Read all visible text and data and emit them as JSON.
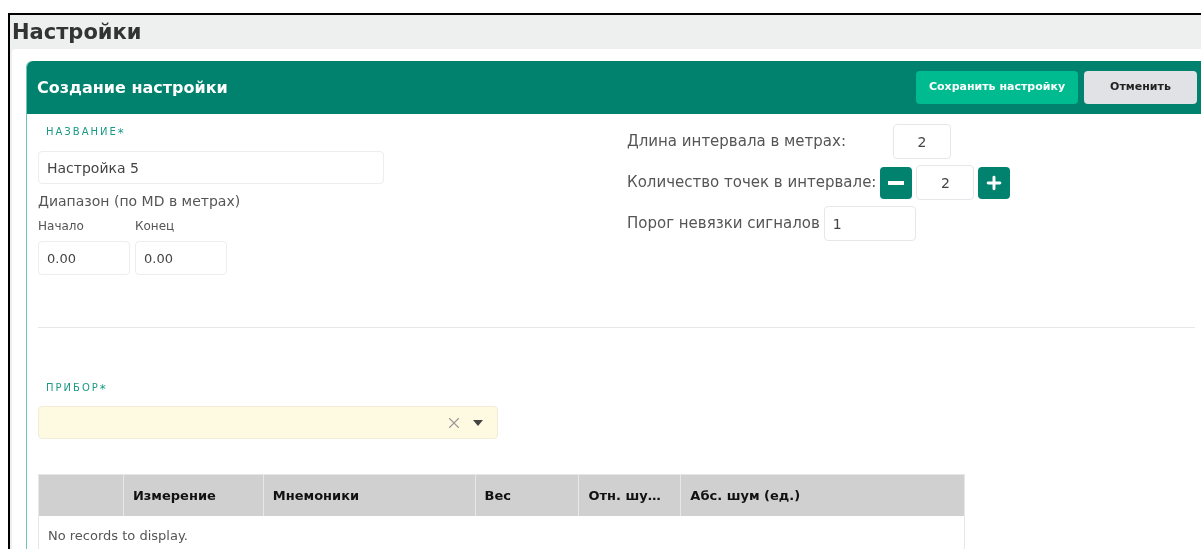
{
  "page_title": "Настройки",
  "panel": {
    "title": "Создание настройки",
    "buttons": [
      {
        "label": "Сохранить настройку",
        "kind": "primary"
      },
      {
        "label": "Отменить",
        "kind": "secondary"
      }
    ]
  },
  "name_field": {
    "label": "НАЗВАНИЕ",
    "required_mark": "*",
    "value": "Настройка 5"
  },
  "range": {
    "title": "Диапазон (по MD в метрах)",
    "start": {
      "label": "Начало",
      "value": "0.00"
    },
    "end": {
      "label": "Конец",
      "value": "0.00"
    }
  },
  "params": [
    {
      "label": "Длина интервала в метрах:",
      "value": "2",
      "kind": "plain"
    },
    {
      "label": "Количество точек в интервале:",
      "value": "2",
      "kind": "stepper"
    },
    {
      "label": "Порог невязки сигналов",
      "value": "1",
      "kind": "wide"
    }
  ],
  "device_field": {
    "label": "ПРИБОР",
    "required_mark": "*"
  },
  "table": {
    "columns": [
      "Измерение",
      "Мнемоники",
      "Вес",
      "Отн. шу…",
      "Абс. шум (ед.)"
    ],
    "empty_text": "No records to display."
  }
}
